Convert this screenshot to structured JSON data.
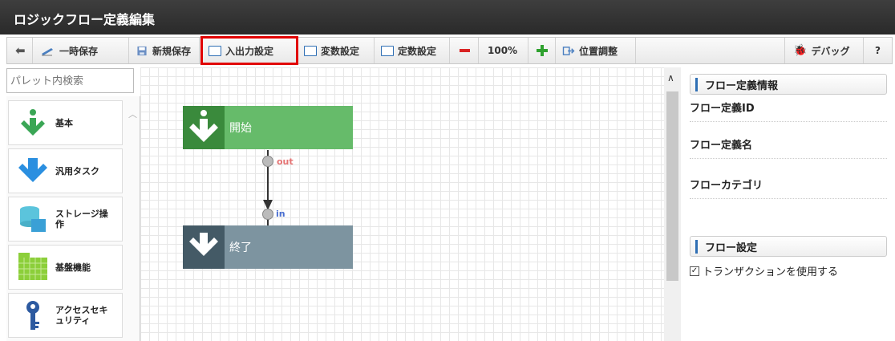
{
  "window": {
    "title": "ロジックフロー定義編集"
  },
  "toolbar": {
    "back_icon": "arrow-left-icon",
    "temp_save": "一時保存",
    "new_save": "新規保存",
    "io_settings": "入出力設定",
    "var_settings": "変数設定",
    "const_settings": "定数設定",
    "zoom": "100%",
    "position": "位置調整",
    "debug": "デバッグ",
    "help": "?",
    "colors": {
      "highlight": "#e10000",
      "minus": "#d92323",
      "plus": "#2fa12f"
    }
  },
  "palette": {
    "search_placeholder": "パレット内検索",
    "items": [
      {
        "label": "基本",
        "icon": "arrow-down-green-icon"
      },
      {
        "label": "汎用タスク",
        "icon": "arrow-down-blue-icon"
      },
      {
        "label": "ストレージ操作",
        "icon": "storage-icon"
      },
      {
        "label": "基盤機能",
        "icon": "grid-blocks-icon"
      },
      {
        "label": "アクセスセキュリティ",
        "icon": "key-icon"
      }
    ]
  },
  "canvas": {
    "start_node": "開始",
    "end_node": "終了",
    "out_port": "out",
    "in_port": "in",
    "colors": {
      "start": "#66bb6a",
      "start_icon": "#3a8a3c",
      "end": "#7d94a0",
      "end_icon": "#445a66",
      "out": "#e57373",
      "in": "#4a6fd1"
    }
  },
  "properties": {
    "flow_info_header": "フロー定義情報",
    "flow_id_label": "フロー定義ID",
    "flow_name_label": "フロー定義名",
    "flow_category_label": "フローカテゴリ",
    "flow_settings_header": "フロー設定",
    "transaction_label": "トランザクションを使用する",
    "transaction_checked": true
  }
}
